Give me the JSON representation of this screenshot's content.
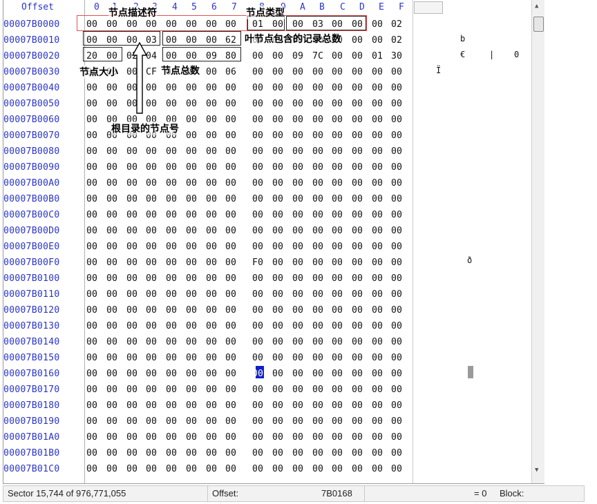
{
  "header": {
    "offset_label": "Offset",
    "columns": [
      "0",
      "1",
      "2",
      "3",
      "4",
      "5",
      "6",
      "7",
      "8",
      "9",
      "A",
      "B",
      "C",
      "D",
      "E",
      "F"
    ]
  },
  "rows": [
    {
      "offset": "00007B0000",
      "bytes": [
        "00",
        "00",
        "00",
        "00",
        "00",
        "00",
        "00",
        "00",
        "01",
        "00",
        "00",
        "03",
        "00",
        "00",
        "00",
        "02"
      ]
    },
    {
      "offset": "00007B0010",
      "bytes": [
        "00",
        "00",
        "00",
        "03",
        "00",
        "00",
        "00",
        "62",
        "00",
        "00",
        "00",
        "00",
        "00",
        "00",
        "00",
        "02"
      ]
    },
    {
      "offset": "00007B0020",
      "bytes": [
        "20",
        "00",
        "02",
        "04",
        "00",
        "00",
        "09",
        "80",
        "00",
        "00",
        "09",
        "7C",
        "00",
        "00",
        "01",
        "30"
      ]
    },
    {
      "offset": "00007B0030",
      "bytes": [
        "00",
        "00",
        "00",
        "CF",
        "00",
        "00",
        "00",
        "06",
        "00",
        "00",
        "00",
        "00",
        "00",
        "00",
        "00",
        "00"
      ]
    },
    {
      "offset": "00007B0040",
      "bytes": [
        "00",
        "00",
        "00",
        "00",
        "00",
        "00",
        "00",
        "00",
        "00",
        "00",
        "00",
        "00",
        "00",
        "00",
        "00",
        "00"
      ]
    },
    {
      "offset": "00007B0050",
      "bytes": [
        "00",
        "00",
        "00",
        "00",
        "00",
        "00",
        "00",
        "00",
        "00",
        "00",
        "00",
        "00",
        "00",
        "00",
        "00",
        "00"
      ]
    },
    {
      "offset": "00007B0060",
      "bytes": [
        "00",
        "00",
        "00",
        "00",
        "00",
        "00",
        "00",
        "00",
        "00",
        "00",
        "00",
        "00",
        "00",
        "00",
        "00",
        "00"
      ]
    },
    {
      "offset": "00007B0070",
      "bytes": [
        "00",
        "00",
        "00",
        "00",
        "00",
        "00",
        "00",
        "00",
        "00",
        "00",
        "00",
        "00",
        "00",
        "00",
        "00",
        "00"
      ]
    },
    {
      "offset": "00007B0080",
      "bytes": [
        "00",
        "00",
        "00",
        "00",
        "00",
        "00",
        "00",
        "00",
        "00",
        "00",
        "00",
        "00",
        "00",
        "00",
        "00",
        "00"
      ]
    },
    {
      "offset": "00007B0090",
      "bytes": [
        "00",
        "00",
        "00",
        "00",
        "00",
        "00",
        "00",
        "00",
        "00",
        "00",
        "00",
        "00",
        "00",
        "00",
        "00",
        "00"
      ]
    },
    {
      "offset": "00007B00A0",
      "bytes": [
        "00",
        "00",
        "00",
        "00",
        "00",
        "00",
        "00",
        "00",
        "00",
        "00",
        "00",
        "00",
        "00",
        "00",
        "00",
        "00"
      ]
    },
    {
      "offset": "00007B00B0",
      "bytes": [
        "00",
        "00",
        "00",
        "00",
        "00",
        "00",
        "00",
        "00",
        "00",
        "00",
        "00",
        "00",
        "00",
        "00",
        "00",
        "00"
      ]
    },
    {
      "offset": "00007B00C0",
      "bytes": [
        "00",
        "00",
        "00",
        "00",
        "00",
        "00",
        "00",
        "00",
        "00",
        "00",
        "00",
        "00",
        "00",
        "00",
        "00",
        "00"
      ]
    },
    {
      "offset": "00007B00D0",
      "bytes": [
        "00",
        "00",
        "00",
        "00",
        "00",
        "00",
        "00",
        "00",
        "00",
        "00",
        "00",
        "00",
        "00",
        "00",
        "00",
        "00"
      ]
    },
    {
      "offset": "00007B00E0",
      "bytes": [
        "00",
        "00",
        "00",
        "00",
        "00",
        "00",
        "00",
        "00",
        "00",
        "00",
        "00",
        "00",
        "00",
        "00",
        "00",
        "00"
      ]
    },
    {
      "offset": "00007B00F0",
      "bytes": [
        "00",
        "00",
        "00",
        "00",
        "00",
        "00",
        "00",
        "00",
        "F0",
        "00",
        "00",
        "00",
        "00",
        "00",
        "00",
        "00"
      ]
    },
    {
      "offset": "00007B0100",
      "bytes": [
        "00",
        "00",
        "00",
        "00",
        "00",
        "00",
        "00",
        "00",
        "00",
        "00",
        "00",
        "00",
        "00",
        "00",
        "00",
        "00"
      ]
    },
    {
      "offset": "00007B0110",
      "bytes": [
        "00",
        "00",
        "00",
        "00",
        "00",
        "00",
        "00",
        "00",
        "00",
        "00",
        "00",
        "00",
        "00",
        "00",
        "00",
        "00"
      ]
    },
    {
      "offset": "00007B0120",
      "bytes": [
        "00",
        "00",
        "00",
        "00",
        "00",
        "00",
        "00",
        "00",
        "00",
        "00",
        "00",
        "00",
        "00",
        "00",
        "00",
        "00"
      ]
    },
    {
      "offset": "00007B0130",
      "bytes": [
        "00",
        "00",
        "00",
        "00",
        "00",
        "00",
        "00",
        "00",
        "00",
        "00",
        "00",
        "00",
        "00",
        "00",
        "00",
        "00"
      ]
    },
    {
      "offset": "00007B0140",
      "bytes": [
        "00",
        "00",
        "00",
        "00",
        "00",
        "00",
        "00",
        "00",
        "00",
        "00",
        "00",
        "00",
        "00",
        "00",
        "00",
        "00"
      ]
    },
    {
      "offset": "00007B0150",
      "bytes": [
        "00",
        "00",
        "00",
        "00",
        "00",
        "00",
        "00",
        "00",
        "00",
        "00",
        "00",
        "00",
        "00",
        "00",
        "00",
        "00"
      ]
    },
    {
      "offset": "00007B0160",
      "bytes": [
        "00",
        "00",
        "00",
        "00",
        "00",
        "00",
        "00",
        "00",
        "00",
        "00",
        "00",
        "00",
        "00",
        "00",
        "00",
        "00"
      ]
    },
    {
      "offset": "00007B0170",
      "bytes": [
        "00",
        "00",
        "00",
        "00",
        "00",
        "00",
        "00",
        "00",
        "00",
        "00",
        "00",
        "00",
        "00",
        "00",
        "00",
        "00"
      ]
    },
    {
      "offset": "00007B0180",
      "bytes": [
        "00",
        "00",
        "00",
        "00",
        "00",
        "00",
        "00",
        "00",
        "00",
        "00",
        "00",
        "00",
        "00",
        "00",
        "00",
        "00"
      ]
    },
    {
      "offset": "00007B0190",
      "bytes": [
        "00",
        "00",
        "00",
        "00",
        "00",
        "00",
        "00",
        "00",
        "00",
        "00",
        "00",
        "00",
        "00",
        "00",
        "00",
        "00"
      ]
    },
    {
      "offset": "00007B01A0",
      "bytes": [
        "00",
        "00",
        "00",
        "00",
        "00",
        "00",
        "00",
        "00",
        "00",
        "00",
        "00",
        "00",
        "00",
        "00",
        "00",
        "00"
      ]
    },
    {
      "offset": "00007B01B0",
      "bytes": [
        "00",
        "00",
        "00",
        "00",
        "00",
        "00",
        "00",
        "00",
        "00",
        "00",
        "00",
        "00",
        "00",
        "00",
        "00",
        "00"
      ]
    },
    {
      "offset": "00007B01C0",
      "bytes": [
        "00",
        "00",
        "00",
        "00",
        "00",
        "00",
        "00",
        "00",
        "00",
        "00",
        "00",
        "00",
        "00",
        "00",
        "00",
        "00"
      ]
    }
  ],
  "text_pane": {
    "row1": "b",
    "row2_a": "€",
    "row2_b": "|",
    "row2_c": "0",
    "row3": "Ï",
    "row15": "ð"
  },
  "annotations": {
    "node_descriptor": "节点描述符",
    "node_type": "节点类型",
    "leaf_records_total": "叶节点包含的记录总数",
    "node_size": "节点大小",
    "node_total": "节点总数",
    "root_node_number": "根目录的节点号"
  },
  "status": {
    "sector": "Sector 15,744 of 976,771,055",
    "offset_label": "Offset:",
    "offset_value": "7B0168",
    "equals": "= 0",
    "block_label": "Block:"
  },
  "colors": {
    "offset_blue": "#2b35c9",
    "selection": "#1020c8",
    "red_box": "#e05050"
  }
}
